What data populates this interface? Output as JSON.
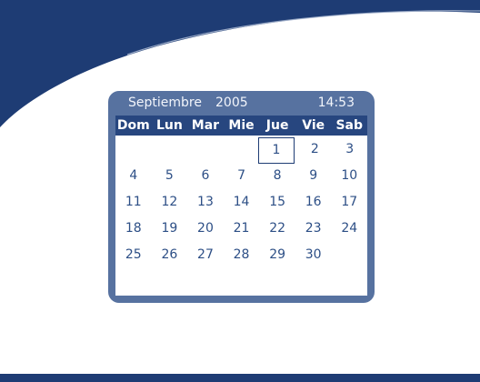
{
  "colors": {
    "navy": "#1e3c74",
    "frame": "#5772a0",
    "header_text": "#f2f5fb",
    "weekday_bg": "#27467f",
    "weekday_text": "#ffffff",
    "body_bg": "#ffffff",
    "day_text": "#2d4f86",
    "selected_border": "#1e3c74"
  },
  "calendar": {
    "month": "Septiembre",
    "year": "2005",
    "time": "14:53",
    "weekdays": [
      "Dom",
      "Lun",
      "Mar",
      "Mie",
      "Jue",
      "Vie",
      "Sab"
    ],
    "selected_day": "1",
    "weeks": [
      [
        "",
        "",
        "",
        "",
        "1",
        "2",
        "3"
      ],
      [
        "4",
        "5",
        "6",
        "7",
        "8",
        "9",
        "10"
      ],
      [
        "11",
        "12",
        "13",
        "14",
        "15",
        "16",
        "17"
      ],
      [
        "18",
        "19",
        "20",
        "21",
        "22",
        "23",
        "24"
      ],
      [
        "25",
        "26",
        "27",
        "28",
        "29",
        "30",
        ""
      ]
    ]
  }
}
